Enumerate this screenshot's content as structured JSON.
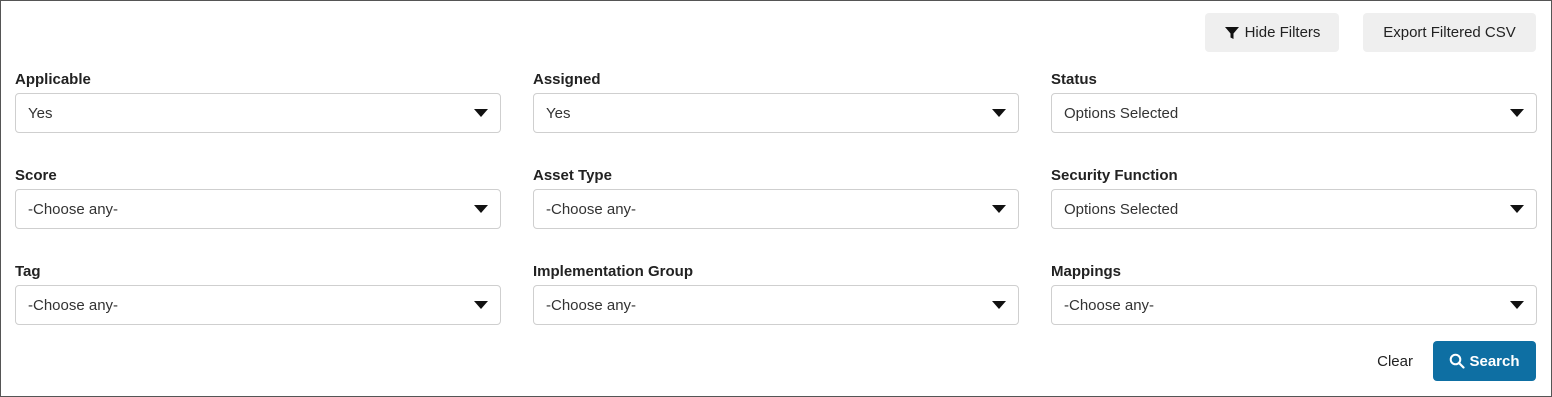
{
  "toolbar": {
    "hide_filters_label": "Hide Filters",
    "export_label": "Export Filtered CSV",
    "filter_icon": "filter-icon"
  },
  "filters": [
    {
      "label": "Applicable",
      "value": "Yes"
    },
    {
      "label": "Assigned",
      "value": "Yes"
    },
    {
      "label": "Status",
      "value": "Options Selected"
    },
    {
      "label": "Score",
      "value": "-Choose any-"
    },
    {
      "label": "Asset Type",
      "value": "-Choose any-"
    },
    {
      "label": "Security Function",
      "value": "Options Selected"
    },
    {
      "label": "Tag",
      "value": "-Choose any-"
    },
    {
      "label": "Implementation Group",
      "value": "-Choose any-"
    },
    {
      "label": "Mappings",
      "value": "-Choose any-"
    }
  ],
  "actions": {
    "clear_label": "Clear",
    "search_label": "Search",
    "search_icon": "search-icon",
    "search_color": "#0e6fa3"
  }
}
